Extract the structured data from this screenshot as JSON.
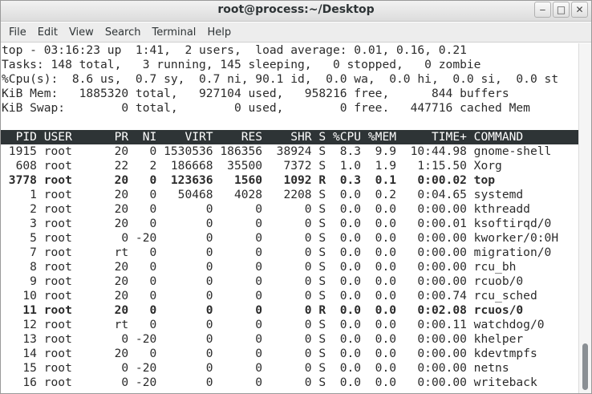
{
  "window": {
    "title": "root@process:~/Desktop",
    "minimize_glyph": "‒",
    "maximize_glyph": "□",
    "close_glyph": "✕"
  },
  "menubar": {
    "items": [
      "File",
      "Edit",
      "View",
      "Search",
      "Terminal",
      "Help"
    ]
  },
  "top_summary": [
    "top - 03:16:23 up  1:41,  2 users,  load average: 0.01, 0.16, 0.21",
    "Tasks: 148 total,   3 running, 145 sleeping,   0 stopped,   0 zombie",
    "%Cpu(s):  8.6 us,  0.7 sy,  0.7 ni, 90.1 id,  0.0 wa,  0.0 hi,  0.0 si,  0.0 st",
    "KiB Mem:   1885320 total,   927104 used,   958216 free,      844 buffers",
    "KiB Swap:        0 total,        0 used,        0 free.   447716 cached Mem",
    ""
  ],
  "process_header": "  PID USER      PR  NI    VIRT    RES    SHR S %CPU %MEM     TIME+ COMMAND",
  "processes": [
    {
      "text": " 1915 root      20   0 1530536 186356  38924 S  8.3  9.9  10:44.98 gnome-shell",
      "bold": false
    },
    {
      "text": "  608 root      22   2  186668  35500   7372 S  1.0  1.9   1:15.50 Xorg",
      "bold": false
    },
    {
      "text": " 3778 root      20   0  123636   1560   1092 R  0.3  0.1   0:00.02 top",
      "bold": true
    },
    {
      "text": "    1 root      20   0   50468   4028   2208 S  0.0  0.2   0:04.65 systemd",
      "bold": false
    },
    {
      "text": "    2 root      20   0       0      0      0 S  0.0  0.0   0:00.00 kthreadd",
      "bold": false
    },
    {
      "text": "    3 root      20   0       0      0      0 S  0.0  0.0   0:00.01 ksoftirqd/0",
      "bold": false
    },
    {
      "text": "    5 root       0 -20       0      0      0 S  0.0  0.0   0:00.00 kworker/0:0H",
      "bold": false
    },
    {
      "text": "    7 root      rt   0       0      0      0 S  0.0  0.0   0:00.00 migration/0",
      "bold": false
    },
    {
      "text": "    8 root      20   0       0      0      0 S  0.0  0.0   0:00.00 rcu_bh",
      "bold": false
    },
    {
      "text": "    9 root      20   0       0      0      0 S  0.0  0.0   0:00.00 rcuob/0",
      "bold": false
    },
    {
      "text": "   10 root      20   0       0      0      0 S  0.0  0.0   0:00.74 rcu_sched",
      "bold": false
    },
    {
      "text": "   11 root      20   0       0      0      0 R  0.0  0.0   0:02.08 rcuos/0",
      "bold": true
    },
    {
      "text": "   12 root      rt   0       0      0      0 S  0.0  0.0   0:00.11 watchdog/0",
      "bold": false
    },
    {
      "text": "   13 root       0 -20       0      0      0 S  0.0  0.0   0:00.00 khelper",
      "bold": false
    },
    {
      "text": "   14 root      20   0       0      0      0 S  0.0  0.0   0:00.00 kdevtmpfs",
      "bold": false
    },
    {
      "text": "   15 root       0 -20       0      0      0 S  0.0  0.0   0:00.00 netns",
      "bold": false
    },
    {
      "text": "   16 root       0 -20       0      0      0 S  0.0  0.0   0:00.00 writeback",
      "bold": false
    }
  ]
}
